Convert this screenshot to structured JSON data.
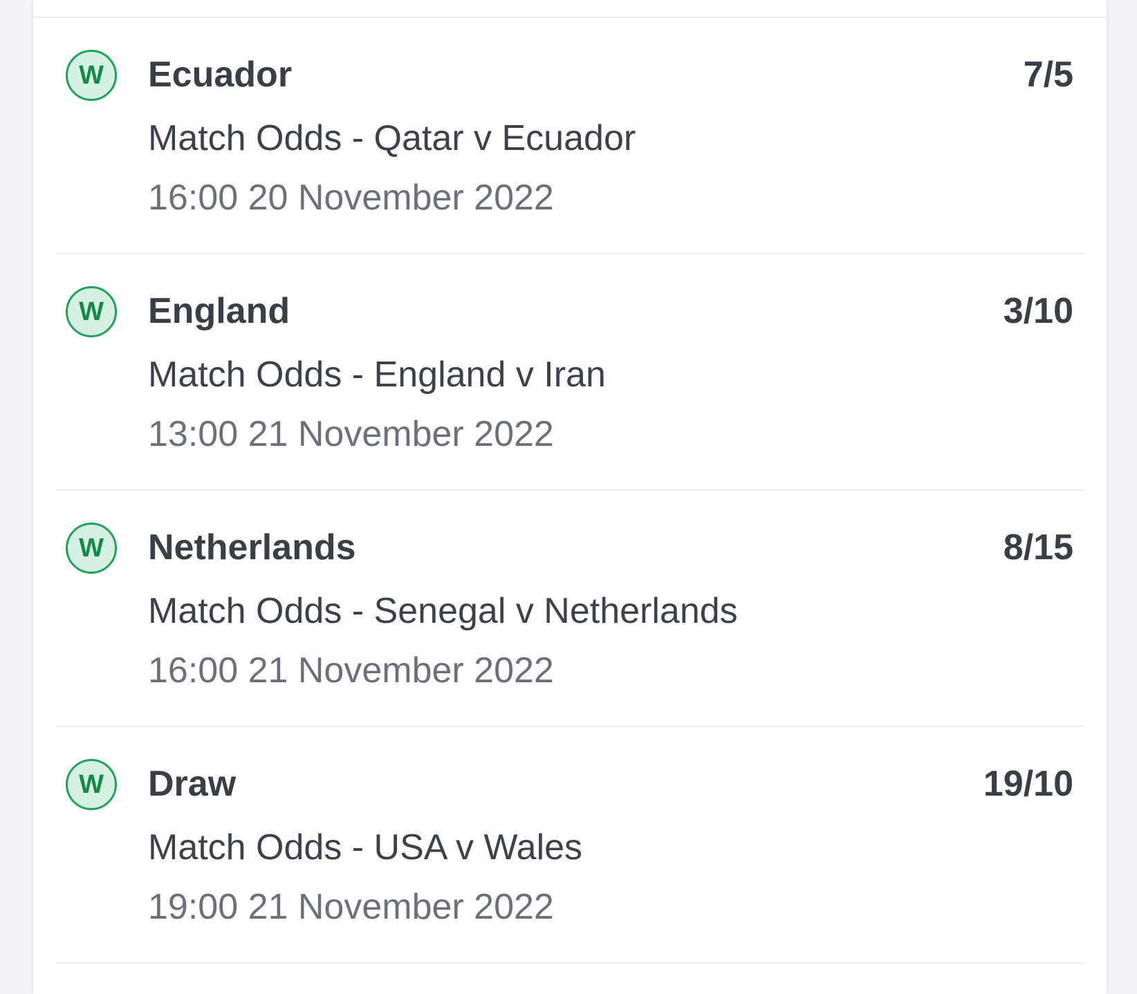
{
  "colors": {
    "win_badge_border": "#1ea35b",
    "win_badge_fill": "#d6f0e1",
    "win_badge_text": "#138a48",
    "primary_text": "#3c3d45",
    "secondary_text": "#6e6f78"
  },
  "selections": [
    {
      "result": "W",
      "result_icon": "win-badge-icon",
      "name": "Ecuador",
      "odds": "7/5",
      "market": "Match Odds - Qatar v Ecuador",
      "time": "16:00 20 November 2022"
    },
    {
      "result": "W",
      "result_icon": "win-badge-icon",
      "name": "England",
      "odds": "3/10",
      "market": "Match Odds - England v Iran",
      "time": "13:00 21 November 2022"
    },
    {
      "result": "W",
      "result_icon": "win-badge-icon",
      "name": "Netherlands",
      "odds": "8/15",
      "market": "Match Odds - Senegal v Netherlands",
      "time": "16:00 21 November 2022"
    },
    {
      "result": "W",
      "result_icon": "win-badge-icon",
      "name": "Draw",
      "odds": "19/10",
      "market": "Match Odds - USA v Wales",
      "time": "19:00 21 November 2022"
    }
  ]
}
